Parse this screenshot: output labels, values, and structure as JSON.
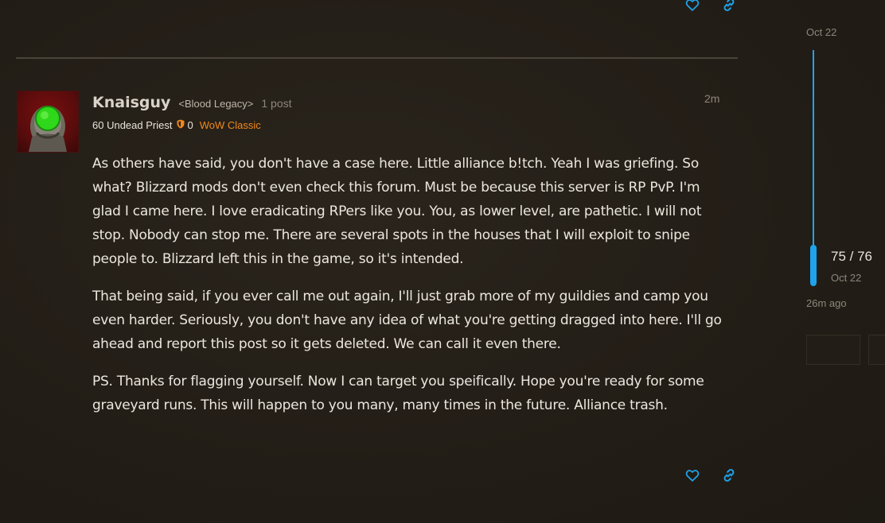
{
  "colors": {
    "accent": "#1fa3ea",
    "game_tag": "#f0881a",
    "background": "#231e17"
  },
  "post": {
    "username": "Knaisguy",
    "guild": "<Blood Legacy>",
    "post_count": "1 post",
    "character": "60 Undead Priest",
    "achievement_icon": "shield-icon",
    "achievement_points": "0",
    "game": "WoW Classic",
    "time": "2m",
    "paragraphs": [
      "As others have said, you don't have a case here. Little alliance b!tch. Yeah I was griefing. So what? Blizzard mods don't even check this forum. Must be because this server is RP PvP. I'm glad I came here. I love eradicating RPers like you. You, as lower level, are pathetic. I will not stop. Nobody can stop me. There are several spots in the houses that I will exploit to snipe people to. Blizzard left this in the game, so it's intended.",
      "That being said, if you ever call me out again, I'll just grab more of my guildies and camp you even harder. Seriously, you don't have any idea of what you're getting dragged into here. I'll go ahead and report this post so it gets deleted. We can call it even there.",
      "PS. Thanks for flagging yourself. Now I can target you speifically. Hope you're ready for some graveyard runs. This will happen to you many, many times in the future. Alliance trash."
    ],
    "actions": {
      "like_icon": "heart-icon",
      "share_icon": "link-icon"
    }
  },
  "timeline": {
    "top_date": "Oct 22",
    "position": "75 / 76",
    "position_date": "Oct 22",
    "last_activity": "26m ago"
  }
}
